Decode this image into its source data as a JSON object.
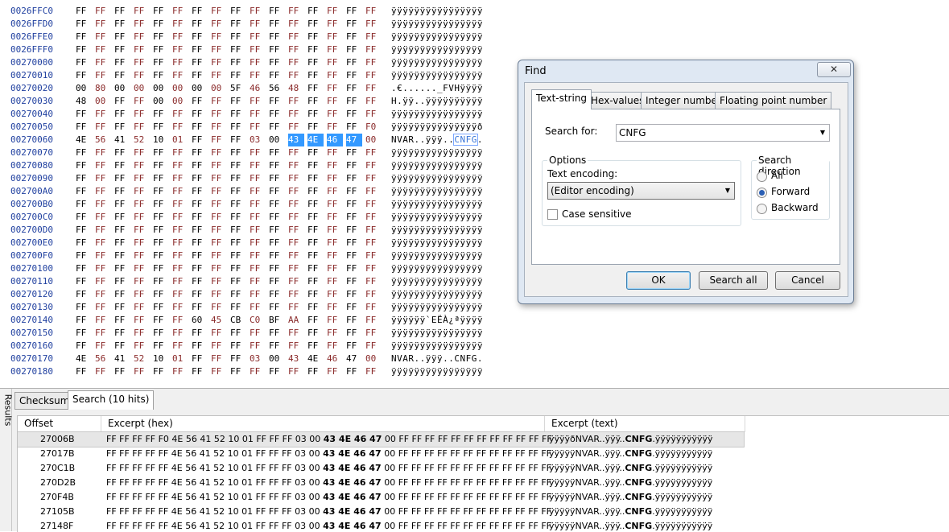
{
  "hex_rows": [
    {
      "offset": "0026FFC0",
      "bytes": [
        "FF",
        "FF",
        "FF",
        "FF",
        "FF",
        "FF",
        "FF",
        "FF",
        "FF",
        "FF",
        "FF",
        "FF",
        "FF",
        "FF",
        "FF",
        "FF"
      ],
      "text": "ÿÿÿÿÿÿÿÿÿÿÿÿÿÿÿÿ"
    },
    {
      "offset": "0026FFD0",
      "bytes": [
        "FF",
        "FF",
        "FF",
        "FF",
        "FF",
        "FF",
        "FF",
        "FF",
        "FF",
        "FF",
        "FF",
        "FF",
        "FF",
        "FF",
        "FF",
        "FF"
      ],
      "text": "ÿÿÿÿÿÿÿÿÿÿÿÿÿÿÿÿ"
    },
    {
      "offset": "0026FFE0",
      "bytes": [
        "FF",
        "FF",
        "FF",
        "FF",
        "FF",
        "FF",
        "FF",
        "FF",
        "FF",
        "FF",
        "FF",
        "FF",
        "FF",
        "FF",
        "FF",
        "FF"
      ],
      "text": "ÿÿÿÿÿÿÿÿÿÿÿÿÿÿÿÿ"
    },
    {
      "offset": "0026FFF0",
      "bytes": [
        "FF",
        "FF",
        "FF",
        "FF",
        "FF",
        "FF",
        "FF",
        "FF",
        "FF",
        "FF",
        "FF",
        "FF",
        "FF",
        "FF",
        "FF",
        "FF"
      ],
      "text": "ÿÿÿÿÿÿÿÿÿÿÿÿÿÿÿÿ"
    },
    {
      "offset": "00270000",
      "bytes": [
        "FF",
        "FF",
        "FF",
        "FF",
        "FF",
        "FF",
        "FF",
        "FF",
        "FF",
        "FF",
        "FF",
        "FF",
        "FF",
        "FF",
        "FF",
        "FF"
      ],
      "text": "ÿÿÿÿÿÿÿÿÿÿÿÿÿÿÿÿ"
    },
    {
      "offset": "00270010",
      "bytes": [
        "FF",
        "FF",
        "FF",
        "FF",
        "FF",
        "FF",
        "FF",
        "FF",
        "FF",
        "FF",
        "FF",
        "FF",
        "FF",
        "FF",
        "FF",
        "FF"
      ],
      "text": "ÿÿÿÿÿÿÿÿÿÿÿÿÿÿÿÿ"
    },
    {
      "offset": "00270020",
      "bytes": [
        "00",
        "80",
        "00",
        "00",
        "00",
        "00",
        "00",
        "00",
        "5F",
        "46",
        "56",
        "48",
        "FF",
        "FF",
        "FF",
        "FF"
      ],
      "text": ".€......_FVHÿÿÿÿ"
    },
    {
      "offset": "00270030",
      "bytes": [
        "48",
        "00",
        "FF",
        "FF",
        "00",
        "00",
        "FF",
        "FF",
        "FF",
        "FF",
        "FF",
        "FF",
        "FF",
        "FF",
        "FF",
        "FF"
      ],
      "text": "H.ÿÿ..ÿÿÿÿÿÿÿÿÿÿ"
    },
    {
      "offset": "00270040",
      "bytes": [
        "FF",
        "FF",
        "FF",
        "FF",
        "FF",
        "FF",
        "FF",
        "FF",
        "FF",
        "FF",
        "FF",
        "FF",
        "FF",
        "FF",
        "FF",
        "FF"
      ],
      "text": "ÿÿÿÿÿÿÿÿÿÿÿÿÿÿÿÿ"
    },
    {
      "offset": "00270050",
      "bytes": [
        "FF",
        "FF",
        "FF",
        "FF",
        "FF",
        "FF",
        "FF",
        "FF",
        "FF",
        "FF",
        "FF",
        "FF",
        "FF",
        "FF",
        "FF",
        "F0"
      ],
      "text": "ÿÿÿÿÿÿÿÿÿÿÿÿÿÿÿð"
    },
    {
      "offset": "00270060",
      "bytes": [
        "4E",
        "56",
        "41",
        "52",
        "10",
        "01",
        "FF",
        "FF",
        "FF",
        "03",
        "00",
        "43",
        "4E",
        "46",
        "47",
        "00"
      ],
      "text": "NVAR..ÿÿÿ..",
      "text_hl": "CNFG",
      "text_tail": ".",
      "sel_from": 11,
      "sel_to": 14
    },
    {
      "offset": "00270070",
      "bytes": [
        "FF",
        "FF",
        "FF",
        "FF",
        "FF",
        "FF",
        "FF",
        "FF",
        "FF",
        "FF",
        "FF",
        "FF",
        "FF",
        "FF",
        "FF",
        "FF"
      ],
      "text": "ÿÿÿÿÿÿÿÿÿÿÿÿÿÿÿÿ"
    },
    {
      "offset": "00270080",
      "bytes": [
        "FF",
        "FF",
        "FF",
        "FF",
        "FF",
        "FF",
        "FF",
        "FF",
        "FF",
        "FF",
        "FF",
        "FF",
        "FF",
        "FF",
        "FF",
        "FF"
      ],
      "text": "ÿÿÿÿÿÿÿÿÿÿÿÿÿÿÿÿ"
    },
    {
      "offset": "00270090",
      "bytes": [
        "FF",
        "FF",
        "FF",
        "FF",
        "FF",
        "FF",
        "FF",
        "FF",
        "FF",
        "FF",
        "FF",
        "FF",
        "FF",
        "FF",
        "FF",
        "FF"
      ],
      "text": "ÿÿÿÿÿÿÿÿÿÿÿÿÿÿÿÿ"
    },
    {
      "offset": "002700A0",
      "bytes": [
        "FF",
        "FF",
        "FF",
        "FF",
        "FF",
        "FF",
        "FF",
        "FF",
        "FF",
        "FF",
        "FF",
        "FF",
        "FF",
        "FF",
        "FF",
        "FF"
      ],
      "text": "ÿÿÿÿÿÿÿÿÿÿÿÿÿÿÿÿ"
    },
    {
      "offset": "002700B0",
      "bytes": [
        "FF",
        "FF",
        "FF",
        "FF",
        "FF",
        "FF",
        "FF",
        "FF",
        "FF",
        "FF",
        "FF",
        "FF",
        "FF",
        "FF",
        "FF",
        "FF"
      ],
      "text": "ÿÿÿÿÿÿÿÿÿÿÿÿÿÿÿÿ"
    },
    {
      "offset": "002700C0",
      "bytes": [
        "FF",
        "FF",
        "FF",
        "FF",
        "FF",
        "FF",
        "FF",
        "FF",
        "FF",
        "FF",
        "FF",
        "FF",
        "FF",
        "FF",
        "FF",
        "FF"
      ],
      "text": "ÿÿÿÿÿÿÿÿÿÿÿÿÿÿÿÿ"
    },
    {
      "offset": "002700D0",
      "bytes": [
        "FF",
        "FF",
        "FF",
        "FF",
        "FF",
        "FF",
        "FF",
        "FF",
        "FF",
        "FF",
        "FF",
        "FF",
        "FF",
        "FF",
        "FF",
        "FF"
      ],
      "text": "ÿÿÿÿÿÿÿÿÿÿÿÿÿÿÿÿ"
    },
    {
      "offset": "002700E0",
      "bytes": [
        "FF",
        "FF",
        "FF",
        "FF",
        "FF",
        "FF",
        "FF",
        "FF",
        "FF",
        "FF",
        "FF",
        "FF",
        "FF",
        "FF",
        "FF",
        "FF"
      ],
      "text": "ÿÿÿÿÿÿÿÿÿÿÿÿÿÿÿÿ"
    },
    {
      "offset": "002700F0",
      "bytes": [
        "FF",
        "FF",
        "FF",
        "FF",
        "FF",
        "FF",
        "FF",
        "FF",
        "FF",
        "FF",
        "FF",
        "FF",
        "FF",
        "FF",
        "FF",
        "FF"
      ],
      "text": "ÿÿÿÿÿÿÿÿÿÿÿÿÿÿÿÿ"
    },
    {
      "offset": "00270100",
      "bytes": [
        "FF",
        "FF",
        "FF",
        "FF",
        "FF",
        "FF",
        "FF",
        "FF",
        "FF",
        "FF",
        "FF",
        "FF",
        "FF",
        "FF",
        "FF",
        "FF"
      ],
      "text": "ÿÿÿÿÿÿÿÿÿÿÿÿÿÿÿÿ"
    },
    {
      "offset": "00270110",
      "bytes": [
        "FF",
        "FF",
        "FF",
        "FF",
        "FF",
        "FF",
        "FF",
        "FF",
        "FF",
        "FF",
        "FF",
        "FF",
        "FF",
        "FF",
        "FF",
        "FF"
      ],
      "text": "ÿÿÿÿÿÿÿÿÿÿÿÿÿÿÿÿ"
    },
    {
      "offset": "00270120",
      "bytes": [
        "FF",
        "FF",
        "FF",
        "FF",
        "FF",
        "FF",
        "FF",
        "FF",
        "FF",
        "FF",
        "FF",
        "FF",
        "FF",
        "FF",
        "FF",
        "FF"
      ],
      "text": "ÿÿÿÿÿÿÿÿÿÿÿÿÿÿÿÿ"
    },
    {
      "offset": "00270130",
      "bytes": [
        "FF",
        "FF",
        "FF",
        "FF",
        "FF",
        "FF",
        "FF",
        "FF",
        "FF",
        "FF",
        "FF",
        "FF",
        "FF",
        "FF",
        "FF",
        "FF"
      ],
      "text": "ÿÿÿÿÿÿÿÿÿÿÿÿÿÿÿÿ"
    },
    {
      "offset": "00270140",
      "bytes": [
        "FF",
        "FF",
        "FF",
        "FF",
        "FF",
        "FF",
        "60",
        "45",
        "CB",
        "C0",
        "BF",
        "AA",
        "FF",
        "FF",
        "FF",
        "FF"
      ],
      "text": "ÿÿÿÿÿÿ`EËÀ¿ªÿÿÿÿ"
    },
    {
      "offset": "00270150",
      "bytes": [
        "FF",
        "FF",
        "FF",
        "FF",
        "FF",
        "FF",
        "FF",
        "FF",
        "FF",
        "FF",
        "FF",
        "FF",
        "FF",
        "FF",
        "FF",
        "FF"
      ],
      "text": "ÿÿÿÿÿÿÿÿÿÿÿÿÿÿÿÿ"
    },
    {
      "offset": "00270160",
      "bytes": [
        "FF",
        "FF",
        "FF",
        "FF",
        "FF",
        "FF",
        "FF",
        "FF",
        "FF",
        "FF",
        "FF",
        "FF",
        "FF",
        "FF",
        "FF",
        "FF"
      ],
      "text": "ÿÿÿÿÿÿÿÿÿÿÿÿÿÿÿÿ"
    },
    {
      "offset": "00270170",
      "bytes": [
        "4E",
        "56",
        "41",
        "52",
        "10",
        "01",
        "FF",
        "FF",
        "FF",
        "03",
        "00",
        "43",
        "4E",
        "46",
        "47",
        "00"
      ],
      "text": "NVAR..ÿÿÿ..CNFG."
    },
    {
      "offset": "00270180",
      "bytes": [
        "FF",
        "FF",
        "FF",
        "FF",
        "FF",
        "FF",
        "FF",
        "FF",
        "FF",
        "FF",
        "FF",
        "FF",
        "FF",
        "FF",
        "FF",
        "FF"
      ],
      "text": "ÿÿÿÿÿÿÿÿÿÿÿÿÿÿÿÿ"
    }
  ],
  "find_dialog": {
    "title": "Find",
    "close_label": "✕",
    "tabs": [
      "Text-string",
      "Hex-values",
      "Integer number",
      "Floating point number"
    ],
    "search_for_label": "Search for:",
    "search_for_value": "CNFG",
    "options_label": "Options",
    "text_encoding_label": "Text encoding:",
    "text_encoding_value": "(Editor encoding)",
    "case_sensitive_label": "Case sensitive",
    "direction_label": "Search direction",
    "direction_options": [
      "All",
      "Forward",
      "Backward"
    ],
    "direction_selected": "Forward",
    "ok_label": "OK",
    "search_all_label": "Search all",
    "cancel_label": "Cancel"
  },
  "results": {
    "side_label": "Results",
    "tabs": [
      "Checksum",
      "Search (10 hits)"
    ],
    "columns": [
      "Offset",
      "Excerpt (hex)",
      "Excerpt (text)"
    ],
    "rows": [
      {
        "offset": "27006B",
        "hex_pre": "FF FF FF FF F0 4E 56 41 52 10 01 FF FF FF 03 00 ",
        "hex_match": "43 4E 46 47",
        "hex_post": " 00 FF FF FF FF FF FF FF FF FF FF FF FF",
        "text_pre": "ÿÿÿÿðNVAR..ÿÿÿ..",
        "text_match": "CNFG",
        "text_post": ".ÿÿÿÿÿÿÿÿÿÿÿ"
      },
      {
        "offset": "27017B",
        "hex_pre": "FF FF FF FF FF 4E 56 41 52 10 01 FF FF FF 03 00 ",
        "hex_match": "43 4E 46 47",
        "hex_post": " 00 FF FF FF FF FF FF FF FF FF FF FF FF",
        "text_pre": "ÿÿÿÿÿNVAR..ÿÿÿ..",
        "text_match": "CNFG",
        "text_post": ".ÿÿÿÿÿÿÿÿÿÿÿ"
      },
      {
        "offset": "270C1B",
        "hex_pre": "FF FF FF FF FF 4E 56 41 52 10 01 FF FF FF 03 00 ",
        "hex_match": "43 4E 46 47",
        "hex_post": " 00 FF FF FF FF FF FF FF FF FF FF FF FF",
        "text_pre": "ÿÿÿÿÿNVAR..ÿÿÿ..",
        "text_match": "CNFG",
        "text_post": ".ÿÿÿÿÿÿÿÿÿÿÿ"
      },
      {
        "offset": "270D2B",
        "hex_pre": "FF FF FF FF FF 4E 56 41 52 10 01 FF FF FF 03 00 ",
        "hex_match": "43 4E 46 47",
        "hex_post": " 00 FF FF FF FF FF FF FF FF FF FF FF FF",
        "text_pre": "ÿÿÿÿÿNVAR..ÿÿÿ..",
        "text_match": "CNFG",
        "text_post": ".ÿÿÿÿÿÿÿÿÿÿÿ"
      },
      {
        "offset": "270F4B",
        "hex_pre": "FF FF FF FF FF 4E 56 41 52 10 01 FF FF FF 03 00 ",
        "hex_match": "43 4E 46 47",
        "hex_post": " 00 FF FF FF FF FF FF FF FF FF FF FF FF",
        "text_pre": "ÿÿÿÿÿNVAR..ÿÿÿ..",
        "text_match": "CNFG",
        "text_post": ".ÿÿÿÿÿÿÿÿÿÿÿ"
      },
      {
        "offset": "27105B",
        "hex_pre": "FF FF FF FF FF 4E 56 41 52 10 01 FF FF FF 03 00 ",
        "hex_match": "43 4E 46 47",
        "hex_post": " 00 FF FF FF FF FF FF FF FF FF FF FF FF",
        "text_pre": "ÿÿÿÿÿNVAR..ÿÿÿ..",
        "text_match": "CNFG",
        "text_post": ".ÿÿÿÿÿÿÿÿÿÿÿ"
      },
      {
        "offset": "27148F",
        "hex_pre": "FF FF FF FF FF 4E 56 41 52 10 01 FF FF FF 03 00 ",
        "hex_match": "43 4E 46 47",
        "hex_post": " 00 FF FF FF FF FF FF FF FF FF FF FF FF",
        "text_pre": "ÿÿÿÿÿNVAR..ÿÿÿ..",
        "text_match": "CNFG",
        "text_post": ".ÿÿÿÿÿÿÿÿÿÿÿ"
      }
    ]
  }
}
